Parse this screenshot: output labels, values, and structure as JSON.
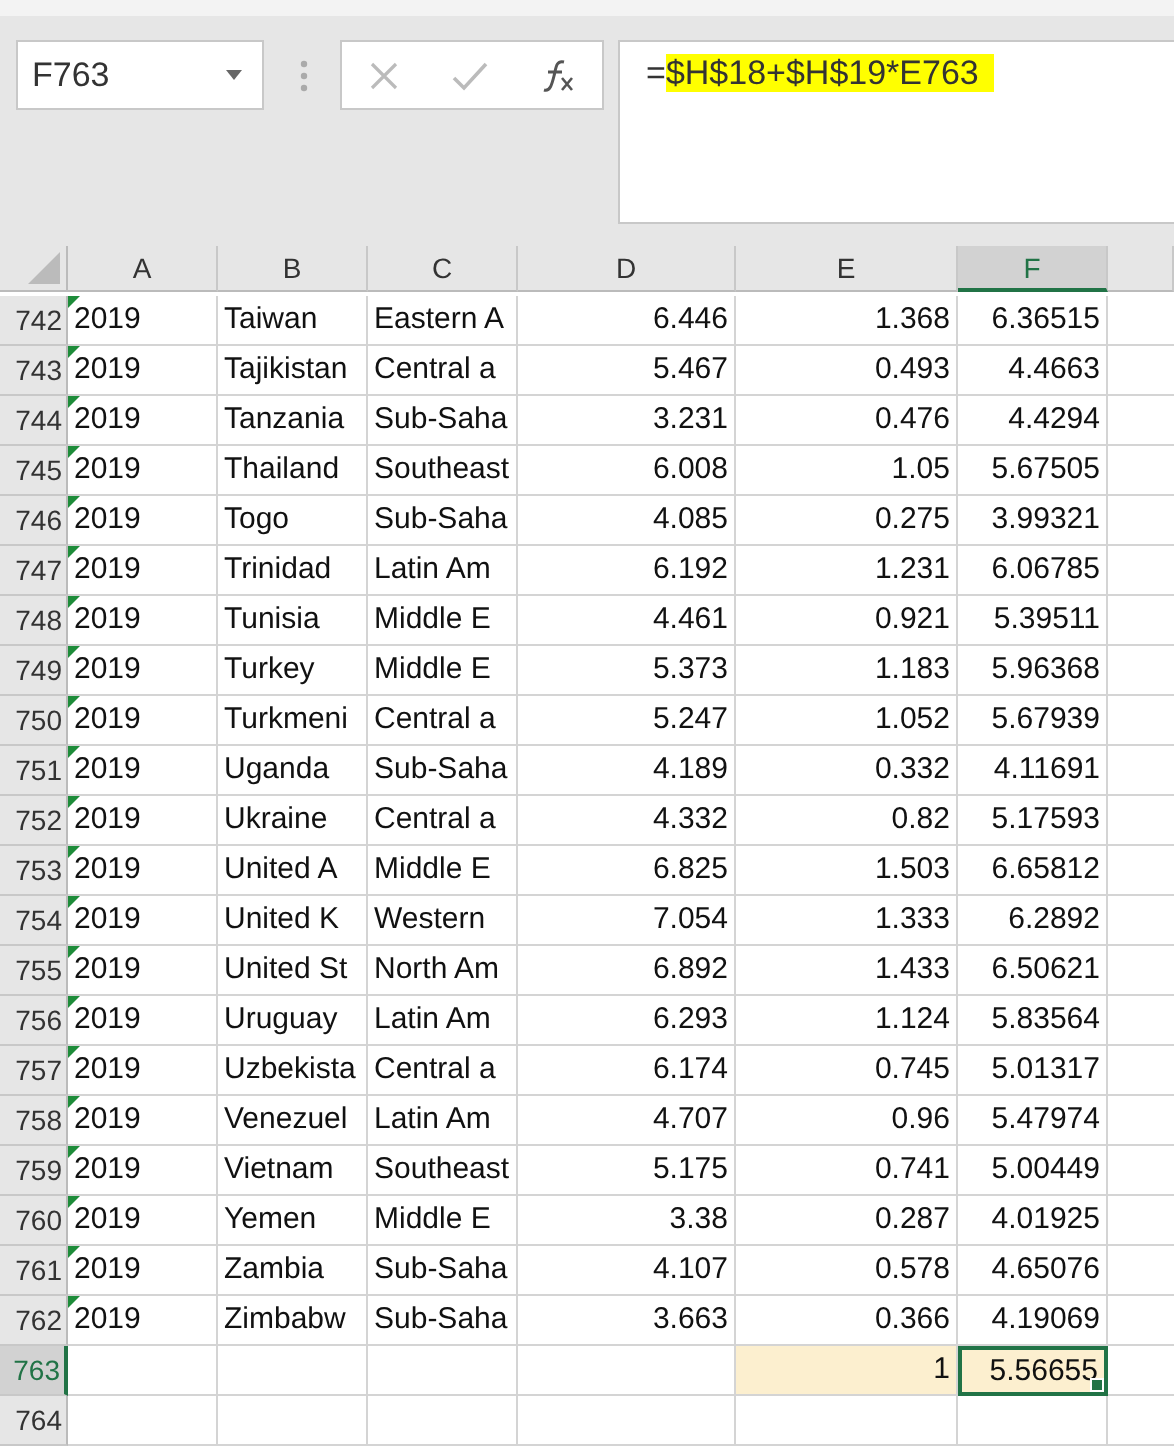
{
  "name_box": {
    "value": "F763"
  },
  "formula_bar": {
    "prefix": "=",
    "highlighted": "$H$18+$H$19*E763"
  },
  "columns": [
    {
      "label": "A",
      "selected": false
    },
    {
      "label": "B",
      "selected": false
    },
    {
      "label": "C",
      "selected": false
    },
    {
      "label": "D",
      "selected": false
    },
    {
      "label": "E",
      "selected": false
    },
    {
      "label": "F",
      "selected": true
    }
  ],
  "rows": [
    {
      "header": "742",
      "selected": false,
      "flag": true,
      "cells": [
        "2019",
        "Taiwan",
        "Eastern A",
        "6.446",
        "1.368",
        "6.36515"
      ]
    },
    {
      "header": "743",
      "selected": false,
      "flag": true,
      "cells": [
        "2019",
        "Tajikistan",
        "Central a",
        "5.467",
        "0.493",
        "4.4663"
      ]
    },
    {
      "header": "744",
      "selected": false,
      "flag": true,
      "cells": [
        "2019",
        "Tanzania",
        "Sub-Saha",
        "3.231",
        "0.476",
        "4.4294"
      ]
    },
    {
      "header": "745",
      "selected": false,
      "flag": true,
      "cells": [
        "2019",
        "Thailand",
        "Southeast",
        "6.008",
        "1.05",
        "5.67505"
      ]
    },
    {
      "header": "746",
      "selected": false,
      "flag": true,
      "cells": [
        "2019",
        "Togo",
        "Sub-Saha",
        "4.085",
        "0.275",
        "3.99321"
      ]
    },
    {
      "header": "747",
      "selected": false,
      "flag": true,
      "cells": [
        "2019",
        "Trinidad",
        "Latin Am",
        "6.192",
        "1.231",
        "6.06785"
      ]
    },
    {
      "header": "748",
      "selected": false,
      "flag": true,
      "cells": [
        "2019",
        "Tunisia",
        "Middle E",
        "4.461",
        "0.921",
        "5.39511"
      ]
    },
    {
      "header": "749",
      "selected": false,
      "flag": true,
      "cells": [
        "2019",
        "Turkey",
        "Middle E",
        "5.373",
        "1.183",
        "5.96368"
      ]
    },
    {
      "header": "750",
      "selected": false,
      "flag": true,
      "cells": [
        "2019",
        "Turkmeni",
        "Central a",
        "5.247",
        "1.052",
        "5.67939"
      ]
    },
    {
      "header": "751",
      "selected": false,
      "flag": true,
      "cells": [
        "2019",
        "Uganda",
        "Sub-Saha",
        "4.189",
        "0.332",
        "4.11691"
      ]
    },
    {
      "header": "752",
      "selected": false,
      "flag": true,
      "cells": [
        "2019",
        "Ukraine",
        "Central a",
        "4.332",
        "0.82",
        "5.17593"
      ]
    },
    {
      "header": "753",
      "selected": false,
      "flag": true,
      "cells": [
        "2019",
        "United A",
        "Middle E",
        "6.825",
        "1.503",
        "6.65812"
      ]
    },
    {
      "header": "754",
      "selected": false,
      "flag": true,
      "cells": [
        "2019",
        "United K",
        "Western",
        "7.054",
        "1.333",
        "6.2892"
      ]
    },
    {
      "header": "755",
      "selected": false,
      "flag": true,
      "cells": [
        "2019",
        "United St",
        "North Am",
        "6.892",
        "1.433",
        "6.50621"
      ]
    },
    {
      "header": "756",
      "selected": false,
      "flag": true,
      "cells": [
        "2019",
        "Uruguay",
        "Latin Am",
        "6.293",
        "1.124",
        "5.83564"
      ]
    },
    {
      "header": "757",
      "selected": false,
      "flag": true,
      "cells": [
        "2019",
        "Uzbekista",
        "Central a",
        "6.174",
        "0.745",
        "5.01317"
      ]
    },
    {
      "header": "758",
      "selected": false,
      "flag": true,
      "cells": [
        "2019",
        "Venezuel",
        "Latin Am",
        "4.707",
        "0.96",
        "5.47974"
      ]
    },
    {
      "header": "759",
      "selected": false,
      "flag": true,
      "cells": [
        "2019",
        "Vietnam",
        "Southeast",
        "5.175",
        "0.741",
        "5.00449"
      ]
    },
    {
      "header": "760",
      "selected": false,
      "flag": true,
      "cells": [
        "2019",
        "Yemen",
        "Middle E",
        "3.38",
        "0.287",
        "4.01925"
      ]
    },
    {
      "header": "761",
      "selected": false,
      "flag": true,
      "cells": [
        "2019",
        "Zambia",
        "Sub-Saha",
        "4.107",
        "0.578",
        "4.65076"
      ]
    },
    {
      "header": "762",
      "selected": false,
      "flag": true,
      "cells": [
        "2019",
        "Zimbabw",
        "Sub-Saha",
        "3.663",
        "0.366",
        "4.19069"
      ]
    },
    {
      "header": "763",
      "selected": true,
      "flag": false,
      "cells": [
        null,
        null,
        null,
        null,
        {
          "text": "1",
          "highlighted": true,
          "selected": false
        },
        {
          "text": "5.56655",
          "highlighted": true,
          "selected": true
        }
      ]
    },
    {
      "header": "764",
      "selected": false,
      "flag": false,
      "cells": [
        null,
        null,
        null,
        null,
        null,
        null
      ]
    }
  ]
}
